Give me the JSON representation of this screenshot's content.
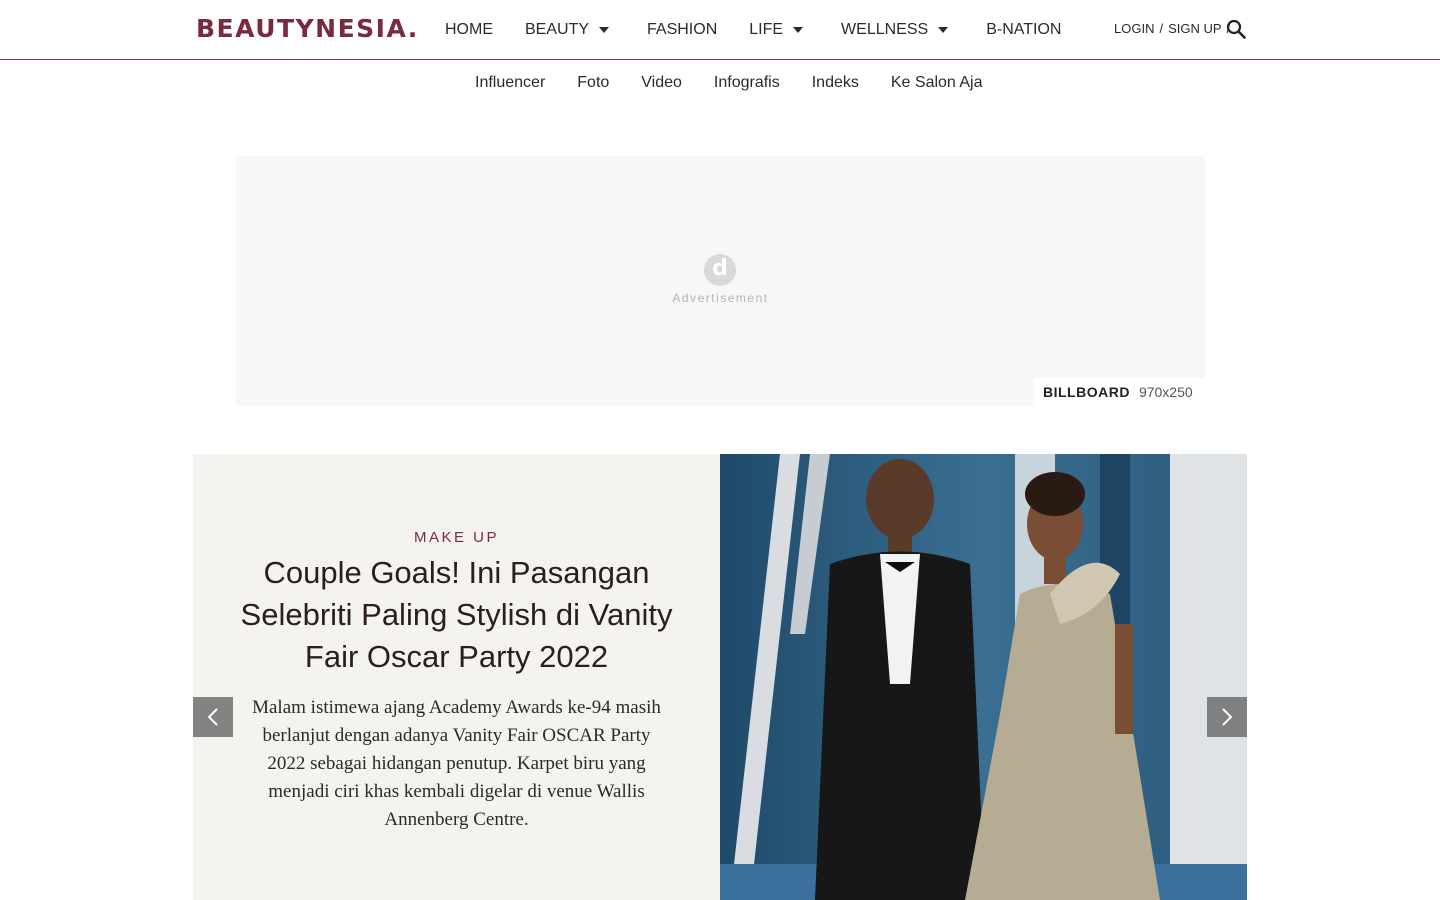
{
  "header": {
    "logo": "BEAUTYNESIA",
    "nav": [
      {
        "label": "HOME",
        "dropdown": false
      },
      {
        "label": "BEAUTY",
        "dropdown": true
      },
      {
        "label": "FASHION",
        "dropdown": false
      },
      {
        "label": "LIFE",
        "dropdown": true
      },
      {
        "label": "WELLNESS",
        "dropdown": true
      },
      {
        "label": "B-NATION",
        "dropdown": false
      }
    ],
    "login": "LOGIN",
    "signup": "SIGN UP",
    "separator": "/"
  },
  "subnav": [
    "Influencer",
    "Foto",
    "Video",
    "Infografis",
    "Indeks",
    "Ke Salon Aja"
  ],
  "ad": {
    "logo_letter": "d",
    "text": "Advertisement",
    "label": "BILLBOARD",
    "size": "970x250"
  },
  "hero": {
    "kicker": "MAKE UP",
    "headline": "Couple Goals! Ini Pasangan Selebriti Paling Stylish di Vanity Fair Oscar Party 2022",
    "excerpt": "Malam istimewa ajang Academy Awards ke-94 masih berlanjut dengan adanya Vanity Fair OSCAR Party 2022 sebagai hidangan penutup. Karpet biru yang menjadi ciri khas kembali digelar di venue Wallis Annenberg Centre."
  },
  "colors": {
    "brand": "#7a2a3f",
    "hero_bg": "#f5f3f0",
    "ad_bg": "#f7f7f7"
  }
}
